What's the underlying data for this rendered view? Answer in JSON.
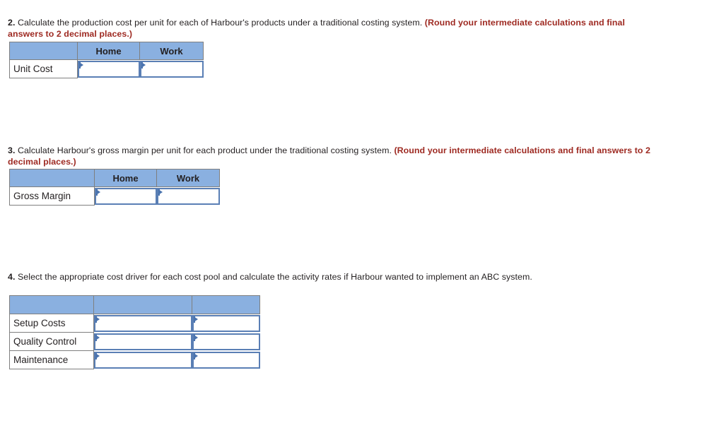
{
  "colors": {
    "header_blue": "#8AB0E0",
    "table_border": "#7F7F7F",
    "input_border": "#5A7FB5",
    "note_red": "#9E2A22",
    "text": "#231F20",
    "background": "#FFFFFF"
  },
  "questions": {
    "q2": {
      "number": "2.",
      "text": " Calculate the production cost per unit for each of Harbour's products under a traditional costing system. ",
      "note": "(Round your intermediate calculations and final answers to 2 decimal places.)"
    },
    "q3": {
      "number": "3.",
      "text": " Calculate Harbour's gross margin per unit for each product under the traditional costing system. ",
      "note": "(Round your intermediate calculations and final answers to 2 decimal places.)"
    },
    "q4": {
      "number": "4.",
      "text": " Select the appropriate cost driver for each cost pool and calculate the activity rates if Harbour wanted to implement an ABC system.",
      "note": ""
    }
  },
  "tables": {
    "unit_cost": {
      "headers": [
        "",
        "Home",
        "Work"
      ],
      "rows": [
        {
          "label": "Unit Cost",
          "values": [
            "",
            ""
          ]
        }
      ]
    },
    "gross_margin": {
      "headers": [
        "",
        "Home",
        "Work"
      ],
      "rows": [
        {
          "label": "Gross Margin",
          "values": [
            "",
            ""
          ]
        }
      ]
    },
    "cost_drivers": {
      "headers": [
        "",
        "",
        ""
      ],
      "rows": [
        {
          "label": "Setup Costs",
          "values": [
            "",
            ""
          ]
        },
        {
          "label": "Quality Control",
          "values": [
            "",
            ""
          ]
        },
        {
          "label": "Maintenance",
          "values": [
            "",
            ""
          ]
        }
      ]
    }
  },
  "input_placeholder": ""
}
